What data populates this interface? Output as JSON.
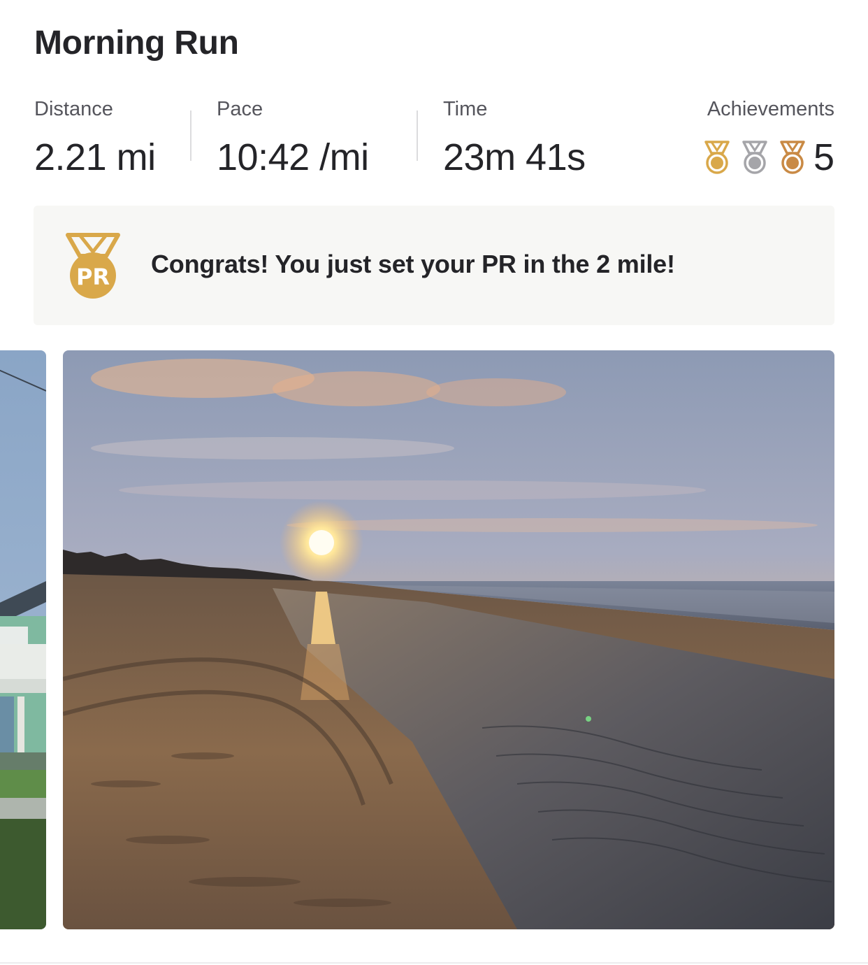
{
  "activity": {
    "title": "Morning Run"
  },
  "stats": {
    "distance": {
      "label": "Distance",
      "value": "2.21 mi"
    },
    "pace": {
      "label": "Pace",
      "value": "10:42 /mi"
    },
    "time": {
      "label": "Time",
      "value": "23m 41s"
    },
    "achievements": {
      "label": "Achievements",
      "count": "5",
      "medals": [
        "gold-medal-icon",
        "silver-medal-icon",
        "bronze-medal-icon"
      ]
    }
  },
  "pr_banner": {
    "badge_text": "PR",
    "message": "Congrats! You just set your PR in the 2 mile!"
  },
  "colors": {
    "gold": "#d9a84a",
    "silver": "#a5a5a9",
    "bronze": "#c98a45",
    "banner_bg": "#f7f7f5",
    "text_primary": "#242428",
    "text_secondary": "#55555c"
  }
}
